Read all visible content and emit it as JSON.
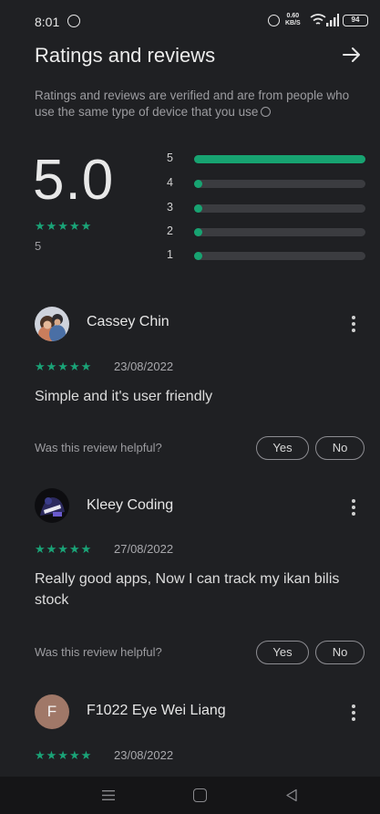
{
  "status_bar": {
    "time": "8:01",
    "net_speed_value": "0.60",
    "net_speed_unit": "KB/S",
    "battery": "94"
  },
  "header": {
    "title": "Ratings and reviews"
  },
  "summary": {
    "verified_note": "Ratings and reviews are verified and are from people who use the same type of device that you use",
    "average": "5.0",
    "stars": "★★★★★",
    "count": "5",
    "distribution": [
      {
        "label": "5",
        "fraction": 1.0
      },
      {
        "label": "4",
        "fraction": 0.0
      },
      {
        "label": "3",
        "fraction": 0.0
      },
      {
        "label": "2",
        "fraction": 0.0
      },
      {
        "label": "1",
        "fraction": 0.0
      }
    ]
  },
  "reviews": [
    {
      "name": "Cassey Chin",
      "stars": "★★★★★",
      "date": "23/08/2022",
      "text": "Simple and it's user friendly",
      "helpful_prompt": "Was this review helpful?",
      "yes_label": "Yes",
      "no_label": "No"
    },
    {
      "name": "Kleey Coding",
      "stars": "★★★★★",
      "date": "27/08/2022",
      "text": "Really good apps, Now I can track my ikan bilis stock",
      "helpful_prompt": "Was this review helpful?",
      "yes_label": "Yes",
      "no_label": "No"
    },
    {
      "name": "F1022 Eye Wei Liang",
      "avatar_letter": "F",
      "stars": "★★★★★",
      "date": "23/08/2022"
    }
  ],
  "colors": {
    "accent": "#17a371",
    "background": "#1f2023",
    "track": "#3b3c40"
  }
}
